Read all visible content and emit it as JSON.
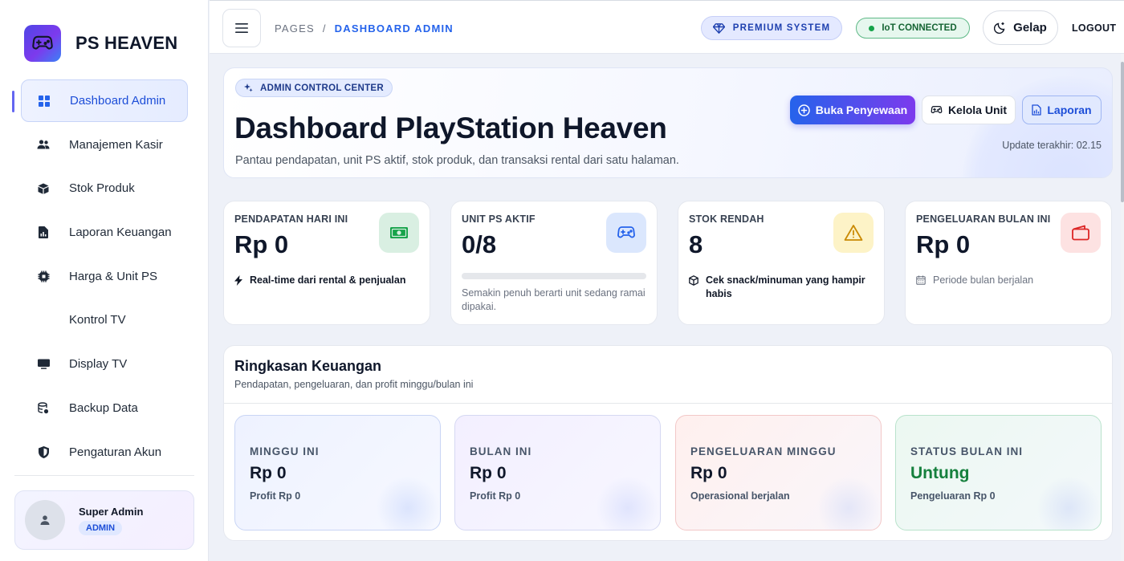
{
  "app": {
    "brand": "PS HEAVEN"
  },
  "sidebar": {
    "items": [
      {
        "label": "Dashboard Admin",
        "icon": "grid-icon",
        "active": true
      },
      {
        "label": "Manajemen Kasir",
        "icon": "users-icon"
      },
      {
        "label": "Stok Produk",
        "icon": "box-icon"
      },
      {
        "label": "Laporan Keuangan",
        "icon": "report-icon"
      },
      {
        "label": "Harga & Unit PS",
        "icon": "chip-icon"
      },
      {
        "label": "Kontrol TV",
        "icon": ""
      },
      {
        "label": "Display TV",
        "icon": "monitor-icon"
      },
      {
        "label": "Backup Data",
        "icon": "database-icon"
      },
      {
        "label": "Pengaturan Akun",
        "icon": "shield-icon"
      }
    ],
    "user": {
      "name": "Super Admin",
      "role": "ADMIN"
    }
  },
  "header": {
    "breadcrumb": [
      "PAGES",
      "DASHBOARD ADMIN"
    ],
    "breadcrumb_sep": "/",
    "premium_label": "PREMIUM SYSTEM",
    "iot_label": "IoT CONNECTED",
    "theme_label": "Gelap",
    "logout_label": "LOGOUT"
  },
  "hero": {
    "badge": "ADMIN CONTROL CENTER",
    "title": "Dashboard PlayStation Heaven",
    "subtitle": "Pantau pendapatan, unit PS aktif, stok produk, dan transaksi rental dari satu halaman.",
    "buttons": {
      "primary": "Buka Penyewaan",
      "manage": "Kelola Unit",
      "report": "Laporan"
    },
    "update_text": "Update terakhir: 02.15"
  },
  "stats": [
    {
      "label": "PENDAPATAN HARI INI",
      "value": "Rp 0",
      "note": "Real-time dari rental & penjualan",
      "icon": "cash-icon"
    },
    {
      "label": "UNIT PS AKTIF",
      "value": "0/8",
      "note": "Semakin penuh berarti unit sedang ramai dipakai.",
      "icon": "gamepad-icon",
      "progress": 0
    },
    {
      "label": "STOK RENDAH",
      "value": "8",
      "note": "Cek snack/minuman yang hampir habis",
      "icon": "warning-icon"
    },
    {
      "label": "PENGELUARAN BULAN INI",
      "value": "Rp 0",
      "note": "Periode bulan berjalan",
      "icon": "wallet-icon"
    }
  ],
  "summary": {
    "title": "Ringkasan Keuangan",
    "subtitle": "Pendapatan, pengeluaran, dan profit minggu/bulan ini",
    "cards": [
      {
        "label": "MINGGU INI",
        "value": "Rp 0",
        "note": "Profit Rp 0"
      },
      {
        "label": "BULAN INI",
        "value": "Rp 0",
        "note": "Profit Rp 0"
      },
      {
        "label": "PENGELUARAN MINGGU",
        "value": "Rp 0",
        "note": "Operasional berjalan"
      },
      {
        "label": "STATUS BULAN INI",
        "value": "Untung",
        "note": "Pengeluaran Rp 0"
      }
    ]
  },
  "colors": {
    "accent": "#2563eb",
    "accent_purple": "#7c3aed",
    "success": "#15803d",
    "warning": "#eab308",
    "danger": "#dc2626"
  }
}
